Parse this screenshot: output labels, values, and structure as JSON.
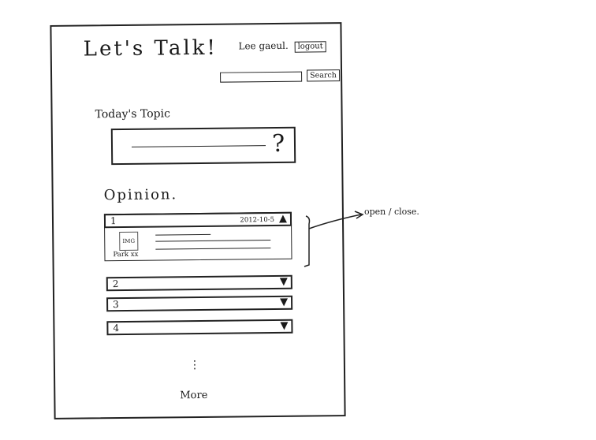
{
  "header": {
    "app_title": "Let's Talk!",
    "user_name": "Lee gaeul.",
    "logout_label": "logout"
  },
  "search": {
    "button_label": "Search",
    "placeholder": ""
  },
  "topic": {
    "label": "Today's Topic",
    "question_mark": "?"
  },
  "opinion": {
    "label": "Opinion.",
    "items": [
      {
        "number": "1",
        "date": "2012-10-5",
        "state": "open",
        "arrow": "▲"
      },
      {
        "number": "2",
        "state": "closed",
        "arrow": "▼"
      },
      {
        "number": "3",
        "state": "closed",
        "arrow": "▼"
      },
      {
        "number": "4",
        "state": "closed",
        "arrow": "▼"
      }
    ],
    "open_item": {
      "image_label": "IMG",
      "author": "Park xx"
    }
  },
  "more": {
    "dots": "⋮",
    "label": "More"
  },
  "annotation": {
    "text": "open / close."
  }
}
